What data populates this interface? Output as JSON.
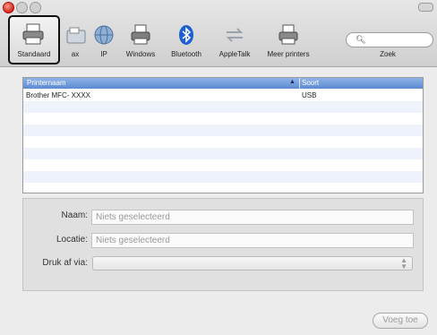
{
  "toolbar": {
    "items": [
      {
        "label": "Standaard",
        "icon": "printer-icon"
      },
      {
        "label": "Fax",
        "icon": "fax-icon"
      },
      {
        "label": "IP",
        "icon": "globe-icon"
      },
      {
        "label": "Windows",
        "icon": "windows-printer-icon"
      },
      {
        "label": "Bluetooth",
        "icon": "bluetooth-icon"
      },
      {
        "label": "AppleTalk",
        "icon": "appletalk-icon"
      },
      {
        "label": "Meer printers",
        "icon": "printer-icon"
      }
    ],
    "search_label": "Zoek",
    "visible_labels": {
      "fax": "ax"
    }
  },
  "list": {
    "columns": [
      "Printernaam",
      "Soort"
    ],
    "rows": [
      {
        "name": "Brother MFC- XXXX",
        "type": "USB"
      }
    ]
  },
  "form": {
    "naam_label": "Naam:",
    "naam_value": "Niets geselecteerd",
    "locatie_label": "Locatie:",
    "locatie_value": "Niets geselecteerd",
    "druk_label": "Druk af via:",
    "druk_value": ""
  },
  "add_button": "Voeg toe",
  "colors": {
    "header_blue": "#6a95d8",
    "row_alt": "#eef3fb",
    "bluetooth": "#1c5fd1"
  }
}
